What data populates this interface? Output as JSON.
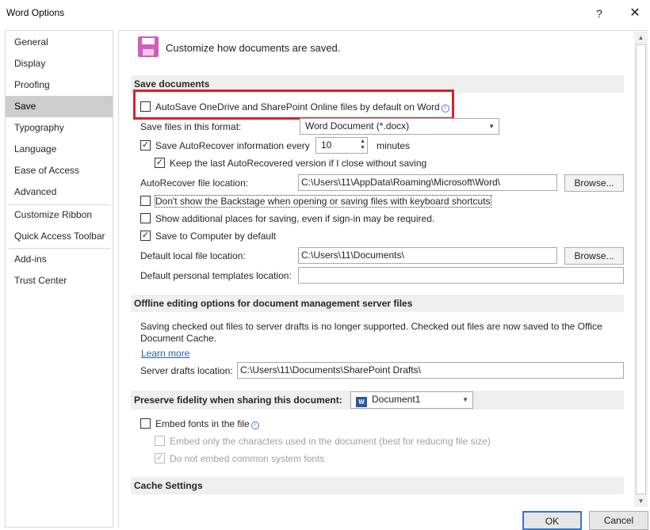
{
  "window": {
    "title": "Word Options",
    "help": "?",
    "close": "✕"
  },
  "sidebar": {
    "items": [
      {
        "label": "General"
      },
      {
        "label": "Display"
      },
      {
        "label": "Proofing"
      },
      {
        "label": "Save"
      },
      {
        "label": "Typography"
      },
      {
        "label": "Language"
      },
      {
        "label": "Ease of Access"
      },
      {
        "label": "Advanced"
      },
      {
        "label": "Customize Ribbon"
      },
      {
        "label": "Quick Access Toolbar"
      },
      {
        "label": "Add-ins"
      },
      {
        "label": "Trust Center"
      }
    ],
    "selected": "Save"
  },
  "header": {
    "text": "Customize how documents are saved."
  },
  "save_documents": {
    "heading": "Save documents",
    "autosave": {
      "label": "AutoSave OneDrive and SharePoint Online files by default on Word",
      "checked": false
    },
    "format_label": "Save files in this format:",
    "format_value": "Word Document (*.docx)",
    "autorecover": {
      "label": "Save AutoRecover information every",
      "checked": true,
      "value": "10",
      "unit": "minutes"
    },
    "keep_last": {
      "label": "Keep the last AutoRecovered version if I close without saving",
      "checked": true
    },
    "autorecover_location_label": "AutoRecover file location:",
    "autorecover_location_value": "C:\\Users\\11\\AppData\\Roaming\\Microsoft\\Word\\",
    "browse1": "Browse...",
    "backstage": {
      "label": "Don't show the Backstage when opening or saving files with keyboard shortcuts",
      "checked": false
    },
    "additional_places": {
      "label": "Show additional places for saving, even if sign-in may be required.",
      "checked": false
    },
    "save_to_computer": {
      "label": "Save to Computer by default",
      "checked": true
    },
    "default_local_label": "Default local file location:",
    "default_local_value": "C:\\Users\\11\\Documents\\",
    "browse2": "Browse...",
    "personal_templates_label": "Default personal templates location:",
    "personal_templates_value": ""
  },
  "offline": {
    "heading": "Offline editing options for document management server files",
    "notice_line1": "Saving checked out files to server drafts is no longer supported. Checked out files are now saved to the Office",
    "notice_line2": "Document Cache.",
    "learn_more": "Learn more",
    "server_drafts_label": "Server drafts location:",
    "server_drafts_value": "C:\\Users\\11\\Documents\\SharePoint Drafts\\"
  },
  "fidelity": {
    "heading": "Preserve fidelity when sharing this document:",
    "document": "Document1",
    "embed_fonts": {
      "label": "Embed fonts in the file",
      "checked": false
    },
    "embed_only": {
      "label": "Embed only the characters used in the document (best for reducing file size)",
      "checked": false
    },
    "no_common": {
      "label": "Do not embed common system fonts",
      "checked": true
    }
  },
  "cache": {
    "heading": "Cache Settings"
  },
  "footer": {
    "ok": "OK",
    "cancel": "Cancel"
  },
  "icons": {
    "save": "save-floppy-icon",
    "info": "info-icon",
    "check": "✓",
    "word_doc": "W"
  },
  "colors": {
    "highlight": "#d4232a",
    "selected_nav": "#cdcdcd",
    "save_icon": "#d05dbd",
    "link": "#2a5fb0"
  }
}
